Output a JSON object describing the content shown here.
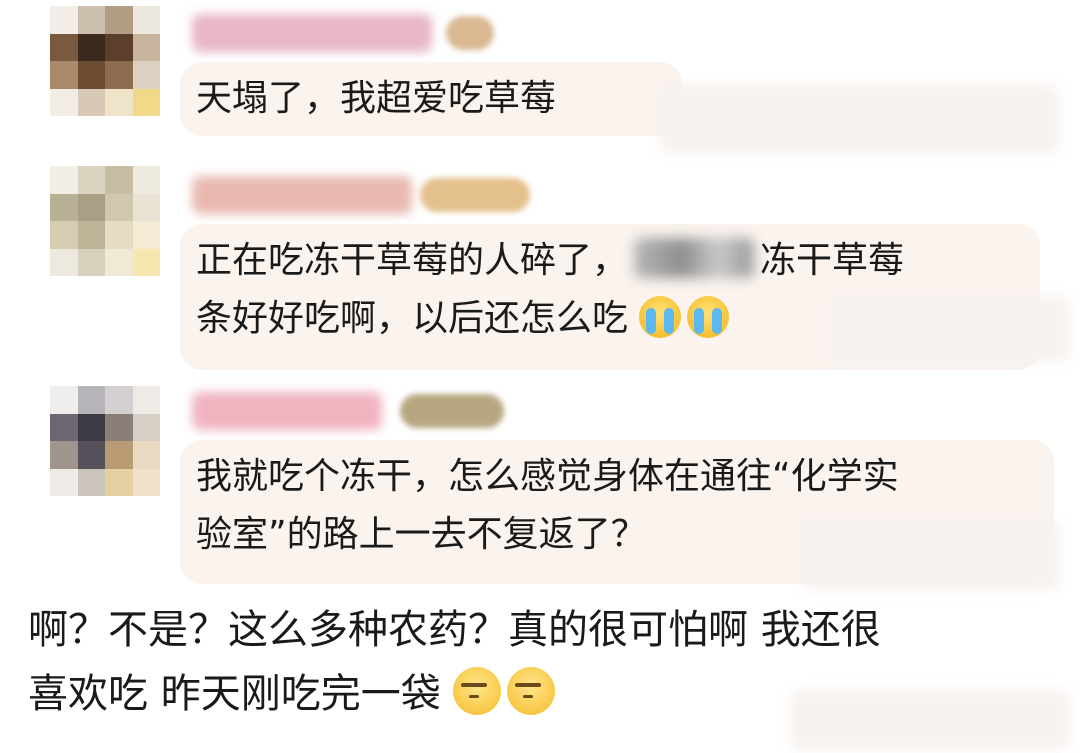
{
  "comments": [
    {
      "text": "天塌了，我超爱吃草莓",
      "username_color": "#e8b6c7"
    },
    {
      "line1_a": "正在吃冻干草莓的人碎了，",
      "line1_b": "冻干草莓",
      "line2": "条好好吃啊，以后还怎么吃",
      "emojis": [
        "crying-face-icon",
        "crying-face-icon"
      ],
      "username_color": "#e9b9b0"
    },
    {
      "line1": "我就吃个冻干，怎么感觉身体在通往“化学实",
      "line2": "验室”的路上一去不复返了？",
      "username_color": "#f0b4c0"
    }
  ],
  "post": {
    "line1": "啊？不是？这么多种农药？真的很可怕啊 我还很",
    "line2": "喜欢吃 昨天刚吃完一袋",
    "emojis": [
      "speechless-face-icon",
      "speechless-face-icon"
    ]
  },
  "colors": {
    "bubble_background": "#faf3ee",
    "text": "#1a1a1a"
  }
}
